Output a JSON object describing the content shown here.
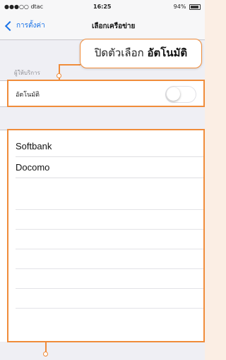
{
  "statusbar": {
    "carrier": "●●●○○ dtac",
    "time": "16:25",
    "battery": "94%"
  },
  "navbar": {
    "back_label": "การตั้งค่า",
    "title": "เลือกเครือข่าย"
  },
  "section_header": "ผู้ให้บริการ",
  "automatic": {
    "label": "อัตโนมัติ",
    "toggle_on": false
  },
  "networks": [
    "Softbank",
    "Docomo"
  ],
  "callout": {
    "text": "ปิดตัวเลือก",
    "emphasis": "อัตโนมัติ"
  },
  "colors": {
    "accent": "#f08c3a",
    "link": "#1a73e8",
    "background": "#efeff4"
  }
}
